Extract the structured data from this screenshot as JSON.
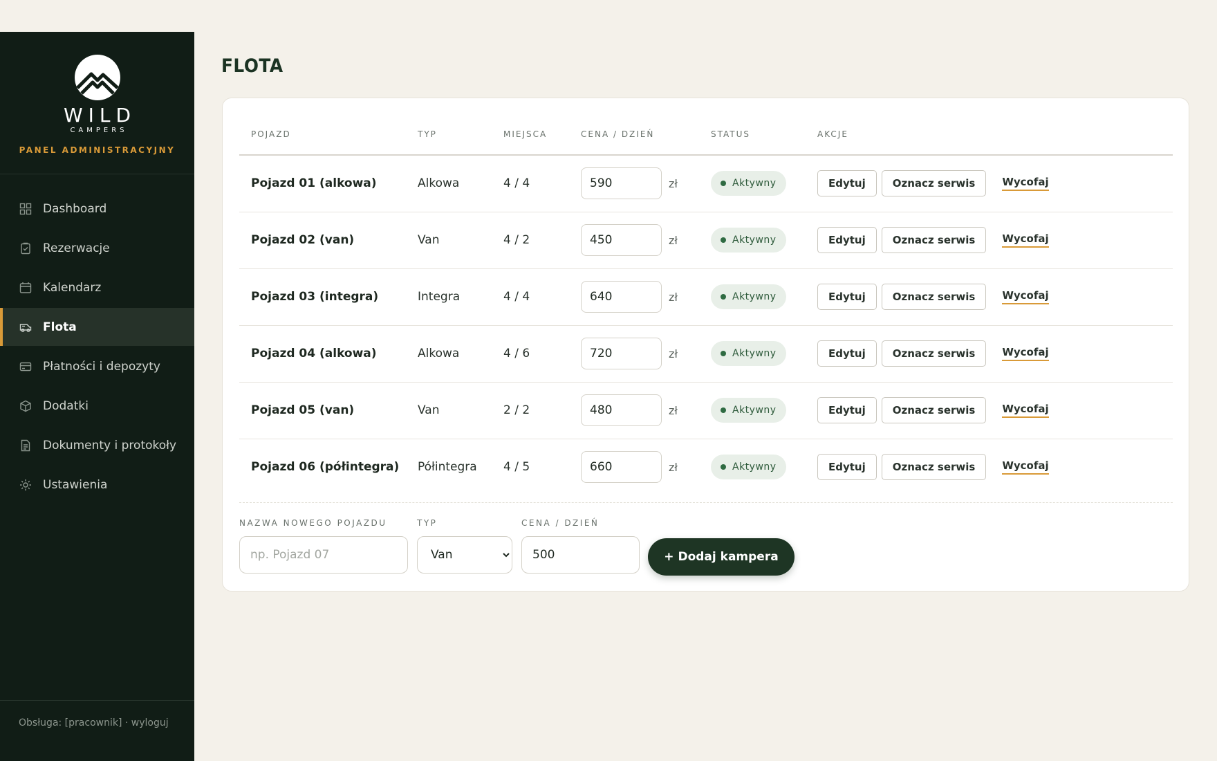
{
  "brand": {
    "name": "WILD",
    "sub": "CAMPERS",
    "panel_label": "PANEL ADMINISTRACYJNY"
  },
  "nav": {
    "items": [
      {
        "label": "Dashboard",
        "icon": "grid-icon"
      },
      {
        "label": "Rezerwacje",
        "icon": "clipboard-icon"
      },
      {
        "label": "Kalendarz",
        "icon": "calendar-icon"
      },
      {
        "label": "Flota",
        "icon": "camper-icon",
        "active": true
      },
      {
        "label": "Płatności i depozyty",
        "icon": "card-icon"
      },
      {
        "label": "Dodatki",
        "icon": "box-icon"
      },
      {
        "label": "Dokumenty i protokoły",
        "icon": "document-icon"
      },
      {
        "label": "Ustawienia",
        "icon": "gear-icon"
      }
    ]
  },
  "footer": {
    "text": "Obsługa: [pracownik] · wyloguj"
  },
  "page": {
    "title": "FLOTA"
  },
  "table": {
    "headers": [
      "POJAZD",
      "TYP",
      "MIEJSCA",
      "CENA / DZIEŃ",
      "STATUS",
      "AKCJE"
    ],
    "currency": "zł",
    "actions": {
      "edit": "Edytuj",
      "service": "Oznacz serwis",
      "withdraw": "Wycofaj"
    },
    "rows": [
      {
        "name": "Pojazd 01 (alkowa)",
        "type": "Alkowa",
        "seats": "4 / 4",
        "price": "590",
        "status": "Aktywny"
      },
      {
        "name": "Pojazd 02 (van)",
        "type": "Van",
        "seats": "4 / 2",
        "price": "450",
        "status": "Aktywny"
      },
      {
        "name": "Pojazd 03 (integra)",
        "type": "Integra",
        "seats": "4 / 4",
        "price": "640",
        "status": "Aktywny"
      },
      {
        "name": "Pojazd 04 (alkowa)",
        "type": "Alkowa",
        "seats": "4 / 6",
        "price": "720",
        "status": "Aktywny"
      },
      {
        "name": "Pojazd 05 (van)",
        "type": "Van",
        "seats": "2 / 2",
        "price": "480",
        "status": "Aktywny"
      },
      {
        "name": "Pojazd 06 (półintegra)",
        "type": "Półintegra",
        "seats": "4 / 5",
        "price": "660",
        "status": "Aktywny"
      }
    ]
  },
  "add_form": {
    "name_label": "NAZWA NOWEGO POJAZDU",
    "name_placeholder": "np. Pojazd 07",
    "type_label": "TYP",
    "type_value": "Van",
    "price_label": "CENA / DZIEŃ",
    "price_value": "500",
    "submit_label": "+ Dodaj kampera"
  },
  "colors": {
    "sidebar_bg": "#111d16",
    "accent": "#d99a38",
    "primary": "#1e3524",
    "status_bg": "#e8efe8"
  }
}
